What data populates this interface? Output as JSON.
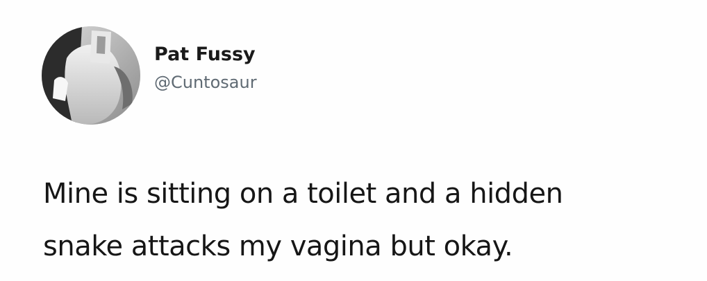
{
  "tweet": {
    "author": {
      "display_name": "Pat Fussy",
      "handle": "@Cuntosaur",
      "avatar_icon": "profile-photo-icon"
    },
    "text_lines": [
      "Mine is sitting on a toilet and a hidden",
      "snake attacks my vagina but okay."
    ]
  },
  "colors": {
    "background": "#ffffff",
    "text": "#161616",
    "handle": "#5f6a73"
  }
}
